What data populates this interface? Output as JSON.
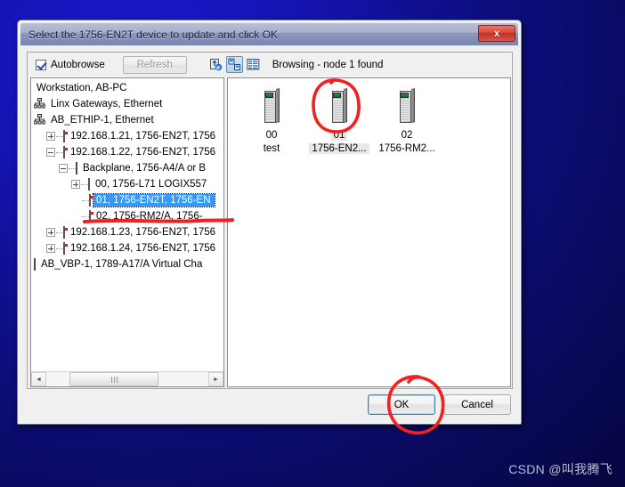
{
  "window": {
    "title": "Select the 1756-EN2T device to update and click OK",
    "close_label": "x"
  },
  "toolbar": {
    "autobrowse_label": "Autobrowse",
    "autobrowse_checked": true,
    "refresh_label": "Refresh",
    "refresh_enabled": false,
    "icons": [
      {
        "name": "refresh-browse-icon",
        "glyph": "↻"
      },
      {
        "name": "icon-view-icon",
        "glyph": "▣",
        "active": true
      },
      {
        "name": "list-view-icon",
        "glyph": "≡"
      }
    ],
    "status": "Browsing - node 1 found"
  },
  "tree": {
    "items": [
      {
        "label": "Workstation, AB-PC",
        "depth": 0,
        "icon": "none",
        "expander": "none",
        "selected": false
      },
      {
        "label": "Linx Gateways, Ethernet",
        "depth": 0,
        "icon": "network",
        "expander": "none",
        "selected": false
      },
      {
        "label": "AB_ETHIP-1, Ethernet",
        "depth": 0,
        "icon": "network",
        "expander": "none",
        "selected": false
      },
      {
        "label": "192.168.1.21, 1756-EN2T, 1756",
        "depth": 1,
        "icon": "module-red",
        "expander": "plus",
        "selected": false
      },
      {
        "label": "192.168.1.22, 1756-EN2T, 1756",
        "depth": 1,
        "icon": "module-red",
        "expander": "minus",
        "selected": false
      },
      {
        "label": "Backplane, 1756-A4/A or B",
        "depth": 2,
        "icon": "backplane",
        "expander": "minus",
        "selected": false
      },
      {
        "label": "00, 1756-L71 LOGIX557",
        "depth": 3,
        "icon": "module-plain",
        "expander": "plus",
        "selected": false
      },
      {
        "label": "01, 1756-EN2T, 1756-EN",
        "depth": 3,
        "icon": "module-red",
        "expander": "none",
        "selected": true
      },
      {
        "label": "02, 1756-RM2/A, 1756-",
        "depth": 3,
        "icon": "module-red",
        "expander": "none",
        "selected": false
      },
      {
        "label": "192.168.1.23, 1756-EN2T, 1756",
        "depth": 1,
        "icon": "module-red",
        "expander": "plus",
        "selected": false
      },
      {
        "label": "192.168.1.24, 1756-EN2T, 1756",
        "depth": 1,
        "icon": "module-red",
        "expander": "plus",
        "selected": false
      },
      {
        "label": "AB_VBP-1, 1789-A17/A Virtual Cha",
        "depth": 0,
        "icon": "backplane",
        "expander": "none",
        "selected": false
      }
    ],
    "scrollbar": {
      "left_arrow": "◄",
      "right_arrow": "►"
    }
  },
  "devices": [
    {
      "slot": "00",
      "name": "test",
      "selected": false
    },
    {
      "slot": "01",
      "name": "1756-EN2...",
      "selected": true
    },
    {
      "slot": "02",
      "name": "1756-RM2...",
      "selected": false
    }
  ],
  "buttons": {
    "ok_label": "OK",
    "cancel_label": "Cancel"
  },
  "annotations": {
    "color": "#f42020",
    "underline_target": "01, 1756-EN2T, 1756-EN",
    "circle_node": "01",
    "circle_button": "OK"
  },
  "watermark": "CSDN @叫我腾飞"
}
